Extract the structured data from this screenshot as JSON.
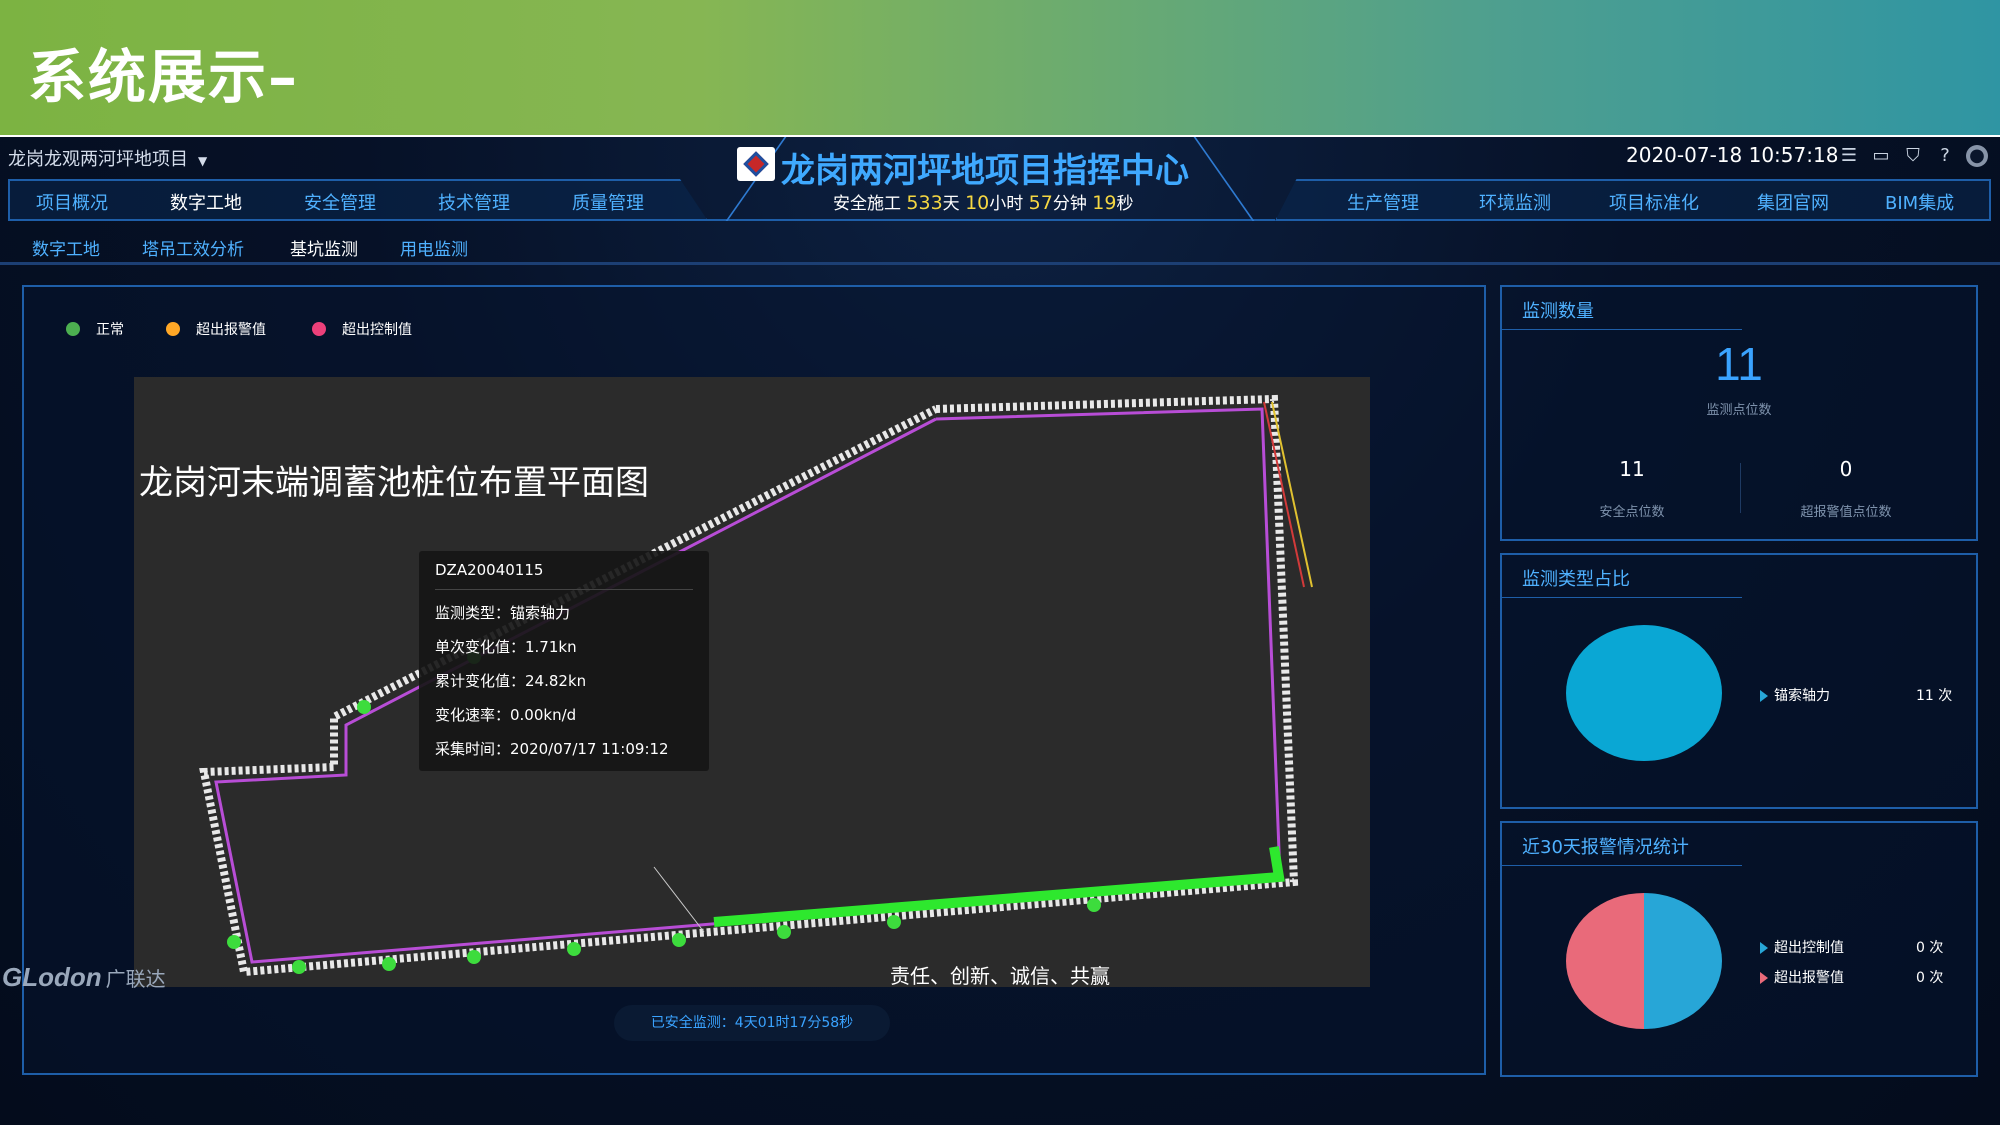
{
  "slide": {
    "title": "系统展示–"
  },
  "header": {
    "project": "龙岗龙观两河坪地项目",
    "title": "龙岗两河坪地项目指挥中心",
    "safe_prefix": "安全施工",
    "days": "533",
    "days_unit": "天",
    "hours": "10",
    "hours_unit": "小时",
    "minutes": "57",
    "minutes_unit": "分钟",
    "seconds": "19",
    "seconds_unit": "秒",
    "datetime": "2020-07-18 10:57:18"
  },
  "nav_left": [
    "项目概况",
    "数字工地",
    "安全管理",
    "技术管理",
    "质量管理"
  ],
  "nav_right": [
    "生产管理",
    "环境监测",
    "项目标准化",
    "集团官网",
    "BIM集成"
  ],
  "subnav": [
    "数字工地",
    "塔吊工效分析",
    "基坑监测",
    "用电监测"
  ],
  "legend": [
    {
      "label": "正常",
      "color": "#4caf50"
    },
    {
      "label": "超出报警值",
      "color": "#ffa726"
    },
    {
      "label": "超出控制值",
      "color": "#ec407a"
    }
  ],
  "plan": {
    "title": "龙岗河末端调蓄池桩位布置平面图"
  },
  "tooltip": {
    "id": "DZA20040115",
    "type": "监测类型：锚索轴力",
    "single": "单次变化值：1.71kn",
    "total": "累计变化值：24.82kn",
    "rate": "变化速率：0.00kn/d",
    "time": "采集时间：2020/07/17 11:09:12"
  },
  "safe_monitor": "已安全监测：4天01时17分58秒",
  "count_panel": {
    "title": "监测数量",
    "total": "11",
    "total_label": "监测点位数",
    "safe": "11",
    "safe_label": "安全点位数",
    "alarm": "0",
    "alarm_label": "超报警值点位数"
  },
  "type_panel": {
    "title": "监测类型占比",
    "items": [
      {
        "label": "锚索轴力",
        "value": "11 次",
        "color": "#0aa7d4"
      }
    ]
  },
  "alarm_panel": {
    "title": "近30天报警情况统计",
    "items": [
      {
        "label": "超出控制值",
        "value": "0 次",
        "color": "#27a6d7"
      },
      {
        "label": "超出报警值",
        "value": "0 次",
        "color": "#e96a7a"
      }
    ]
  },
  "footer": {
    "brand": "GLodon",
    "brand_cn": "广联达",
    "motto": "责任、创新、诚信、共赢"
  }
}
